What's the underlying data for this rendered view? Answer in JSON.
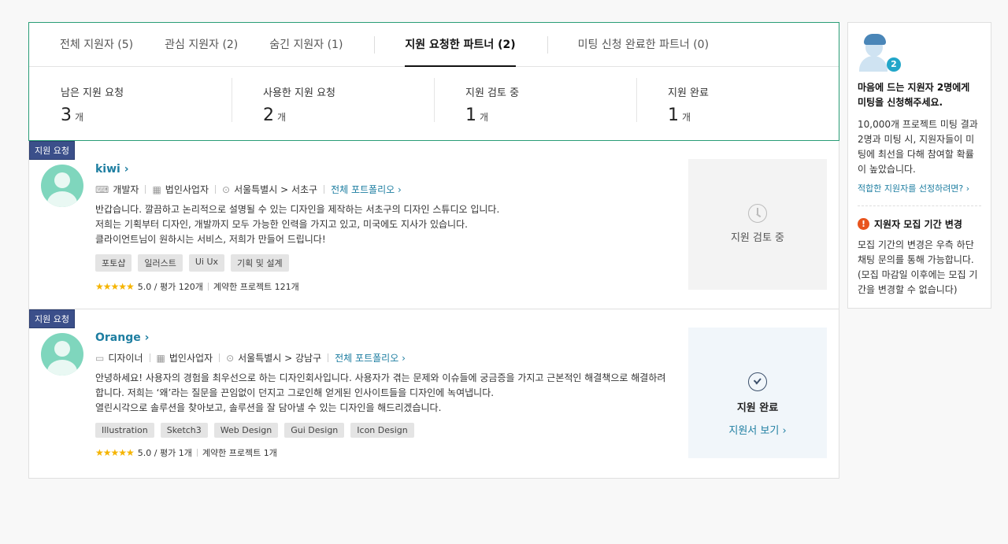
{
  "tabs": [
    {
      "label": "전체 지원자 (5)"
    },
    {
      "label": "관심 지원자 (2)"
    },
    {
      "label": "숨긴 지원자 (1)"
    },
    {
      "label": "지원 요청한 파트너 (2)"
    },
    {
      "label": "미팅 신청 완료한 파트너 (0)"
    }
  ],
  "stats": [
    {
      "label": "남은 지원 요청",
      "value": "3",
      "unit": "개"
    },
    {
      "label": "사용한 지원 요청",
      "value": "2",
      "unit": "개"
    },
    {
      "label": "지원 검토 중",
      "value": "1",
      "unit": "개"
    },
    {
      "label": "지원 완료",
      "value": "1",
      "unit": "개"
    }
  ],
  "partners": [
    {
      "badge": "지원 요청",
      "name": "kiwi",
      "role": "개발자",
      "biz": "법인사업자",
      "location": "서울특별시 > 서초구",
      "portfolio": "전체 포트폴리오",
      "desc1": "반갑습니다.  깔끔하고 논리적으로 설명될 수 있는 디자인을 제작하는 서초구의 디자인 스튜디오 입니다.",
      "desc2": "저희는 기획부터 디자인, 개발까지 모두 가능한 인력을 가지고 있고, 미국에도 지사가 있습니다.",
      "desc3": "클라이언트님이 원하시는 서비스, 저희가 만들어 드립니다!",
      "tags": [
        "포토샵",
        "일러스트",
        "Ui Ux",
        "기획 및 설계"
      ],
      "rating": "5.0 / 평가 120개",
      "contracts": "계약한 프로젝트 121개",
      "status": "지원 검토 중"
    },
    {
      "badge": "지원 요청",
      "name": "Orange",
      "role": "디자이너",
      "biz": "법인사업자",
      "location": "서울특별시 > 강남구",
      "portfolio": "전체 포트폴리오",
      "desc1": "안녕하세요! 사용자의 경험을 최우선으로 하는 디자인회사입니다. 사용자가 겪는 문제와 이슈들에 궁금증을 가지고 근본적인 해결책으로 해결하려",
      "desc2": "합니다. 저희는 ‘왜’라는 질문을 끈임없이 던지고 그로인해 얻게된 인사이트들을 디자인에 녹여냅니다.",
      "desc3": "열린시각으로 솔루션을 찾아보고, 솔루션을 잘 담아낼 수 있는 디자인을 해드리겠습니다.",
      "tags": [
        "Illustration",
        "Sketch3",
        "Web Design",
        "Gui Design",
        "Icon Design"
      ],
      "rating": "5.0 / 평가 1개",
      "contracts": "계약한 프로젝트 1개",
      "status": "지원 완료",
      "status_link": "지원서 보기"
    }
  ],
  "side": {
    "count": "2",
    "title": "마음에 드는 지원자 2명에게 미팅을 신청해주세요.",
    "text": "10,000개 프로젝트 미팅 결과 2명과 미팅 시, 지원자들이 미팅에 최선을 다해 참여할 확률이 높았습니다.",
    "link": "적합한 지원자를 선정하려면?",
    "warn_title": "지원자 모집 기간 변경",
    "warn_text": "모집 기간의 변경은 우측 하단 채팅 문의를 통해 가능합니다.(모집 마감일 이후에는 모집 기간을 변경할 수 없습니다)"
  },
  "colors": {
    "accent": "#2a9d76",
    "link": "#1e7ea1",
    "badge": "#3b4f8a",
    "star": "#f5b400",
    "warn": "#e8541e"
  }
}
